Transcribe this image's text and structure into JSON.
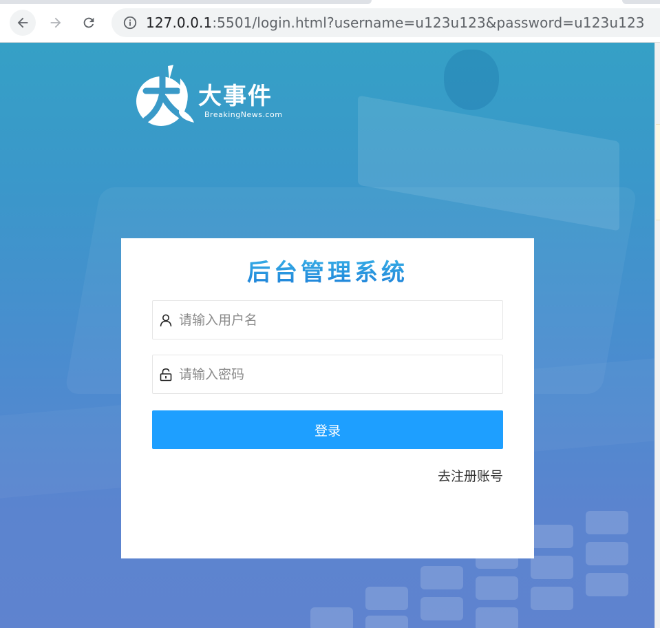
{
  "browser": {
    "url_host": "127.0.0.1",
    "url_rest": ":5501/login.html?username=u123u123&password=u123u123",
    "back_icon": "arrow-left-icon",
    "forward_icon": "arrow-right-icon",
    "reload_icon": "reload-icon",
    "site_info_icon": "info-icon"
  },
  "logo": {
    "brand": "大事件",
    "tagline": "BreakingNews.com"
  },
  "login": {
    "title": "后台管理系统",
    "username_placeholder": "请输入用户名",
    "username_value": "",
    "username_icon": "user-icon",
    "password_placeholder": "请输入密码",
    "password_value": "",
    "password_icon": "lock-icon",
    "submit_label": "登录",
    "register_link": "去注册账号"
  },
  "colors": {
    "primary_button": "#1e9fff",
    "title_gradient_top": "#3ab5e8",
    "title_gradient_bottom": "#1e80d8",
    "background_top": "#35a0c6",
    "background_bottom": "#5f83cf"
  }
}
